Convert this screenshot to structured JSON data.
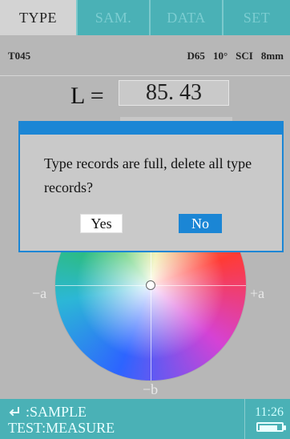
{
  "tabs": [
    {
      "label": "TYPE",
      "active": true
    },
    {
      "label": "SAM.",
      "active": false
    },
    {
      "label": "DATA",
      "active": false
    },
    {
      "label": "SET",
      "active": false
    }
  ],
  "info": {
    "record": "T045",
    "illuminant": "D65",
    "observer": "10°",
    "mode": "SCI",
    "aperture": "8mm"
  },
  "measurement": {
    "label": "L =",
    "value": "85. 43"
  },
  "wheel": {
    "left_label": "−a",
    "right_label": "+a",
    "bottom_label": "−b"
  },
  "dialog": {
    "message": "Type records are full, delete all type records?",
    "yes_label": "Yes",
    "no_label": "No",
    "accent": "#1b86d5"
  },
  "footer": {
    "line1": ":SAMPLE",
    "line2": "TEST:MEASURE",
    "time": "11:26",
    "battery_level": 0.85
  },
  "icons": {
    "enter": "enter-icon",
    "battery": "battery-icon"
  }
}
